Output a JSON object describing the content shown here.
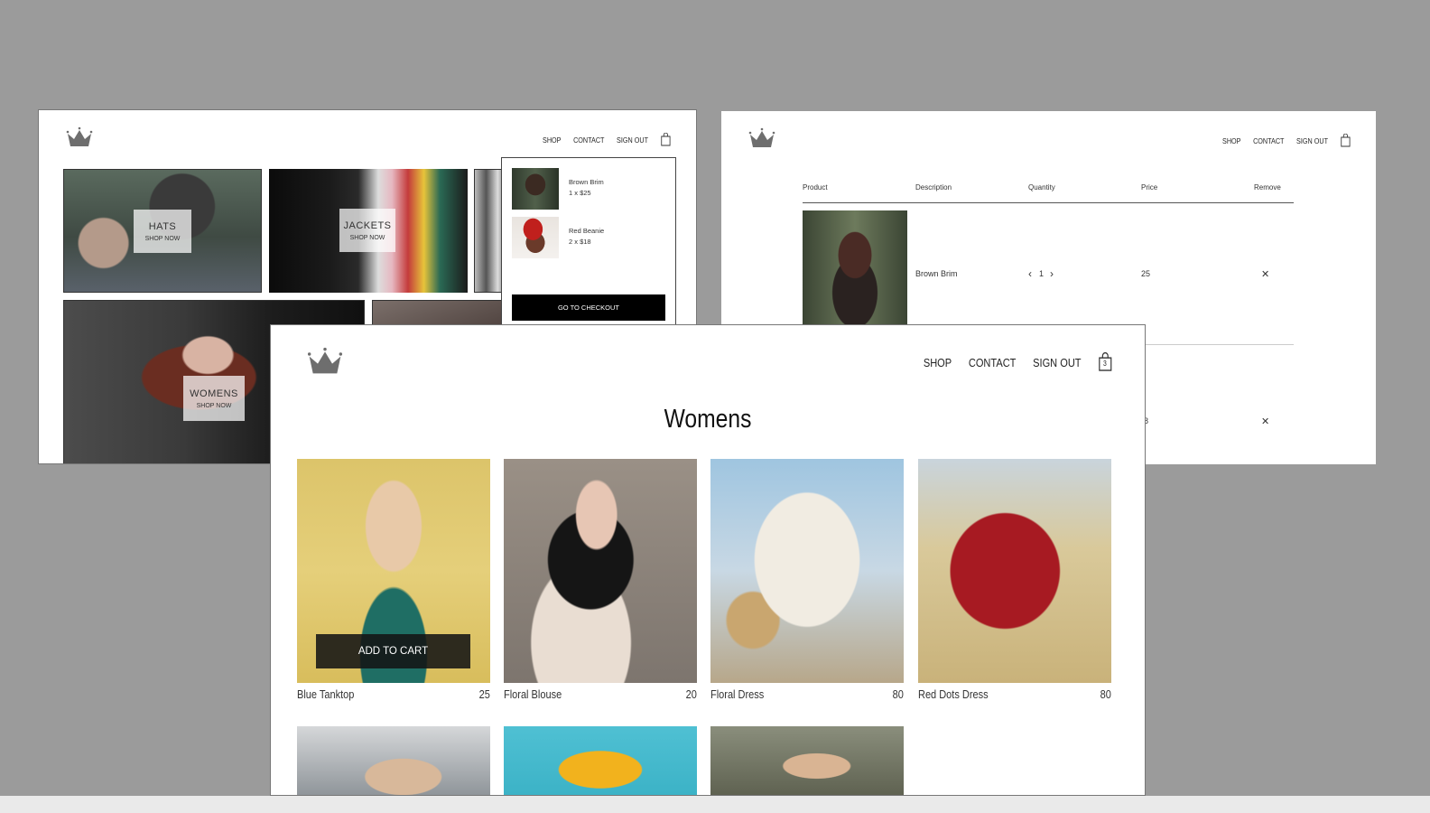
{
  "brand": {
    "logo": "crown-logo"
  },
  "nav": {
    "shop": "SHOP",
    "contact": "CONTACT",
    "sign_out": "SIGN OUT"
  },
  "home_window": {
    "cart_count": "",
    "tiles": [
      {
        "title": "HATS",
        "subtitle": "SHOP NOW"
      },
      {
        "title": "JACKETS",
        "subtitle": "SHOP NOW"
      },
      {
        "title": "WOMENS",
        "subtitle": "SHOP NOW"
      }
    ],
    "cart_dropdown": {
      "items": [
        {
          "name": "Brown Brim",
          "qty_price": "1 x $25"
        },
        {
          "name": "Red Beanie",
          "qty_price": "2 x $18"
        }
      ],
      "checkout_label": "GO TO CHECKOUT"
    }
  },
  "checkout_window": {
    "cart_count": "",
    "headers": {
      "product": "Product",
      "description": "Description",
      "quantity": "Quantity",
      "price": "Price",
      "remove": "Remove"
    },
    "rows": [
      {
        "description": "Brown Brim",
        "quantity": "1",
        "price": "25",
        "remove": "✕"
      },
      {
        "description": "",
        "quantity": "",
        "price": "8",
        "remove": "✕"
      }
    ]
  },
  "shop_window": {
    "cart_count": "3",
    "title": "Womens",
    "add_to_cart": "ADD TO CART",
    "products": [
      {
        "name": "Blue Tanktop",
        "price": "25"
      },
      {
        "name": "Floral Blouse",
        "price": "20"
      },
      {
        "name": "Floral Dress",
        "price": "80"
      },
      {
        "name": "Red Dots Dress",
        "price": "80"
      }
    ]
  },
  "colors": {
    "background": "#9b9b9b",
    "button": "#000000",
    "logo": "#7a7a7a"
  }
}
